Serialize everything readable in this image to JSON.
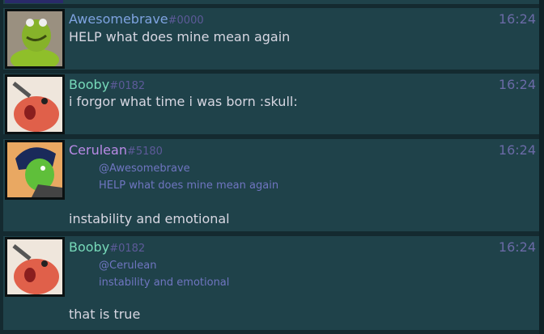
{
  "colors": {
    "background": "#142a30",
    "message_bg": "#1f424a",
    "discriminator": "#5d5a99",
    "time": "#6a6aa6",
    "reply": "#6f75c0",
    "text": "#d7d7e2"
  },
  "messages": [
    {
      "author": "Awesomebrave",
      "discriminator": "#0000",
      "name_color": "#7ea3e0",
      "time": "16:24",
      "text": "HELP what does mine mean again",
      "avatar": "frog-avatar"
    },
    {
      "author": "Booby",
      "discriminator": "#0182",
      "name_color": "#77d9b9",
      "time": "16:24",
      "text": "i forgor what time i was born :skull:",
      "avatar": "red-dog-avatar"
    },
    {
      "author": "Cerulean",
      "discriminator": "#5180",
      "name_color": "#b98ae6",
      "time": "16:24",
      "reply_to": "@Awesomebrave",
      "reply_text": "HELP what does mine mean again",
      "text": "instability and emotional",
      "avatar": "green-cartoon-avatar"
    },
    {
      "author": "Booby",
      "discriminator": "#0182",
      "name_color": "#77d9b9",
      "time": "16:24",
      "reply_to": "@Cerulean",
      "reply_text": "instability and emotional",
      "text": "that is true",
      "avatar": "red-dog-avatar"
    }
  ]
}
